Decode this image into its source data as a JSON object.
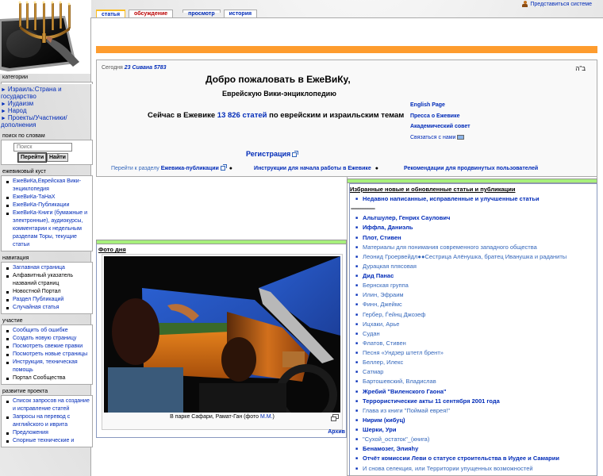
{
  "logo": {
    "alt": "menorah-logo"
  },
  "tabs": [
    {
      "label": "статья",
      "selected": true
    },
    {
      "label": "обсуждение",
      "new": true
    },
    {
      "label": "просмотр"
    },
    {
      "label": "история"
    }
  ],
  "personal": {
    "login_label": "Представиться системе"
  },
  "welcome": {
    "today_label": "Сегодня",
    "today_date": "23 Сивана 5783",
    "bh": "ב\"ה",
    "title": "Добро пожаловать в ЕжеВиКу,",
    "subtitle": "Еврейскую Вики-энциклопедию",
    "count_prefix": "Сейчас в Ежевике",
    "count_value": "13 826 статей",
    "count_suffix": "по еврейским и израильским темам",
    "side_links": [
      "English Page",
      "Пресса о Ежевике",
      "Академический совет",
      "Связаться с нами"
    ],
    "register": "Регистрация",
    "bottom_links": {
      "goto_prefix": "Перейти к разделу",
      "goto_target": "Ежевика-публикации",
      "instructions": "Инструкции для начала работы в Ежевике",
      "recommendations": "Рекомендации для продвинутых пользователей"
    },
    "bullet": "●"
  },
  "photo": {
    "title": "Фото дня",
    "caption_text": "В парке Сафари, Рамат-Ган (фото ",
    "caption_link": "М.М.",
    "caption_end": ")",
    "archive": "Архив"
  },
  "news": {
    "title": "Избранные новые и обновленные статьи и публикации",
    "items": [
      {
        "text": "Недавно написанные, исправленные и улучшенные статьи",
        "style": "bold"
      },
      {
        "text": "--------------------",
        "style": "sep"
      },
      {
        "text": "Альтшулер, Генрих Саулович",
        "style": "bold"
      },
      {
        "text": "Иффла, Даниэль",
        "style": "bold"
      },
      {
        "text": "Плот, Стивен",
        "style": "bold"
      },
      {
        "text": "Материалы для понимания современного западного общества",
        "style": "light"
      },
      {
        "text": "Леонид Гроервейдл●●Сестрица Алёнушка, братец Иванушка и раданиты",
        "style": "light"
      },
      {
        "text": "Дурацкая плясовая",
        "style": "light"
      },
      {
        "text": "Дид Панас",
        "style": "bold"
      },
      {
        "text": "Бернская группа",
        "style": "light"
      },
      {
        "text": "Илин, Эфраим",
        "style": "light"
      },
      {
        "text": "Финн, Джеймс",
        "style": "light"
      },
      {
        "text": "Гербер, Ѓейнц Джозеф",
        "style": "light"
      },
      {
        "text": "Ицхаки, Арье",
        "style": "light"
      },
      {
        "text": "Судан",
        "style": "light"
      },
      {
        "text": "Флатов, Стивен",
        "style": "light"
      },
      {
        "text": "Песня «Ундзер штетл брент»",
        "style": "light"
      },
      {
        "text": "Беллер, Илекс",
        "style": "light"
      },
      {
        "text": "Сатмар",
        "style": "light"
      },
      {
        "text": "Бартошевский, Владислав",
        "style": "light"
      },
      {
        "text": "Жребий \"Виленского Гаона\"",
        "style": "bold"
      },
      {
        "text": "Террористические акты 11 сентября 2001 года",
        "style": "bold"
      },
      {
        "text": "Глава из книги \"Поймай еврея!\"",
        "style": "light"
      },
      {
        "text": "Нирим (кибуц)",
        "style": "bold"
      },
      {
        "text": "Шерки, Ури",
        "style": "bold"
      },
      {
        "text": "\"Сухой_остаток\"_(книга)",
        "style": "light"
      },
      {
        "text": "Бенамозег, Элияhу",
        "style": "bold"
      },
      {
        "text": "Отчёт комиссии Леви о статусе строительства в Иудее и Самарии",
        "style": "bold"
      },
      {
        "text": "И снова селекция, или Территории упущенных возможностей",
        "style": "light"
      }
    ]
  },
  "sidebar": {
    "categories": {
      "header": "категории",
      "items": [
        "Израиль:Страна и государство",
        "Иудаизм",
        "Народ",
        "Проекты/Участники/дополнения"
      ]
    },
    "search": {
      "header": "поиск по словам",
      "placeholder": "Поиск",
      "go_label": "Перейти",
      "find_label": "Найти"
    },
    "bush": {
      "header": "ежевиковый куст",
      "items": [
        {
          "text": "ЕжеВиКа,Еврейская Вики-энциклопедия"
        },
        {
          "text": "ЕжеВиКа-ТаНаХ"
        },
        {
          "text": "ЕжеВиКа-Публикации"
        },
        {
          "text": "ЕжеВиКа-Книги (бумажные и электронные), аудиокурсы, комментарии к недельным разделам Торы, текущие статьи"
        }
      ]
    },
    "navigation": {
      "header": "навигация",
      "items": [
        {
          "text": "Заглавная страница"
        },
        {
          "text": "Алфавитный указатель названий страниц",
          "black": true
        },
        {
          "text": "Новостной Портал",
          "black": true
        },
        {
          "text": "Раздел Публикаций"
        },
        {
          "text": "Случайная статья"
        }
      ]
    },
    "participation": {
      "header": "участие",
      "items": [
        {
          "text": "Сообщить об ошибке"
        },
        {
          "text": "Создать новую страницу"
        },
        {
          "text": "Посмотреть свежие правки"
        },
        {
          "text": "Посмотреть новые страницы"
        },
        {
          "text": "Инструкция, техническая помощь"
        },
        {
          "text": "Портал Сообщества",
          "black": true
        }
      ]
    },
    "development": {
      "header": "развитие проекта",
      "items": [
        {
          "text": "Список запросов на создание и исправление статей"
        },
        {
          "text": "Запросы на перевод с английского и иврита"
        },
        {
          "text": "Предложения"
        },
        {
          "text": "Спорные технические и"
        }
      ]
    }
  }
}
